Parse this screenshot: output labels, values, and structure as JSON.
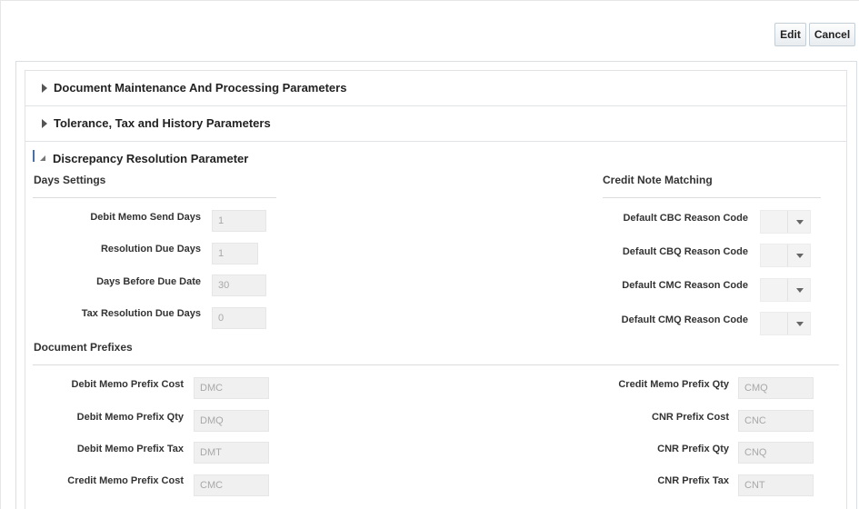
{
  "toolbar": {
    "edit_label": "Edit",
    "cancel_label": "Cancel"
  },
  "sections": [
    {
      "title": "Document Maintenance And Processing Parameters",
      "expanded": false
    },
    {
      "title": "Tolerance, Tax and History Parameters",
      "expanded": false
    },
    {
      "title": "Discrepancy Resolution Parameter",
      "expanded": true
    }
  ],
  "days_settings": {
    "heading": "Days Settings",
    "fields": [
      {
        "label": "Debit Memo Send Days",
        "value": "1"
      },
      {
        "label": "Resolution Due Days",
        "value": "1"
      },
      {
        "label": "Days Before Due Date",
        "value": "30"
      },
      {
        "label": "Tax Resolution Due Days",
        "value": "0"
      }
    ]
  },
  "credit_note_matching": {
    "heading": "Credit Note Matching",
    "selects": [
      {
        "label": "Default CBC Reason Code",
        "value": ""
      },
      {
        "label": "Default CBQ Reason Code",
        "value": ""
      },
      {
        "label": "Default CMC Reason Code",
        "value": ""
      },
      {
        "label": "Default CMQ Reason Code",
        "value": ""
      }
    ]
  },
  "document_prefixes": {
    "heading": "Document Prefixes",
    "left": [
      {
        "label": "Debit Memo Prefix Cost",
        "value": "DMC"
      },
      {
        "label": "Debit Memo Prefix Qty",
        "value": "DMQ"
      },
      {
        "label": "Debit Memo Prefix Tax",
        "value": "DMT"
      },
      {
        "label": "Credit Memo Prefix Cost",
        "value": "CMC"
      }
    ],
    "right": [
      {
        "label": "Credit Memo Prefix Qty",
        "value": "CMQ"
      },
      {
        "label": "CNR Prefix Cost",
        "value": "CNC"
      },
      {
        "label": "CNR Prefix Qty",
        "value": "CNQ"
      },
      {
        "label": "CNR Prefix Tax",
        "value": "CNT"
      }
    ]
  }
}
